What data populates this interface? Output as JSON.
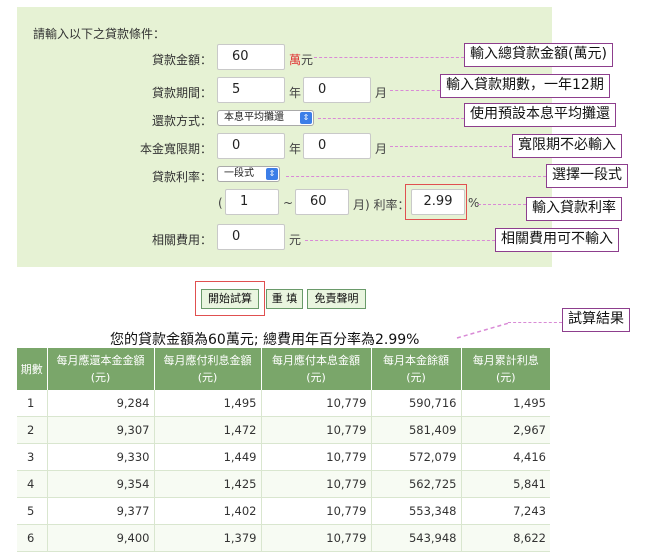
{
  "form": {
    "heading": "請輸入以下之貸款條件：",
    "amount": {
      "label": "貸款金額：",
      "value": "60",
      "unit_red": "萬",
      "unit": "元"
    },
    "period": {
      "label": "貸款期間：",
      "years": "5",
      "years_unit": "年",
      "months": "0",
      "months_unit": "月"
    },
    "method": {
      "label": "還款方式：",
      "selected": "本息平均攤還"
    },
    "grace": {
      "label": "本金寬限期：",
      "years": "0",
      "years_unit": "年",
      "months": "0",
      "months_unit": "月"
    },
    "rate": {
      "label": "貸款利率：",
      "selected": "一段式",
      "paren_open": "(",
      "from": "1",
      "tilde": "~",
      "to": "60",
      "month_label": "月) 利率：",
      "value": "2.99",
      "percent": "%"
    },
    "fee": {
      "label": "相關費用：",
      "value": "0",
      "unit": "元"
    }
  },
  "callouts": {
    "amount": "輸入總貸款金額(萬元)",
    "period": "輸入貸款期數，一年12期",
    "method": "使用預設本息平均攤還",
    "grace": "寬限期不必輸入",
    "rate_type": "選擇一段式",
    "rate": "輸入貸款利率",
    "fee": "相關費用可不輸入",
    "result": "試算結果"
  },
  "buttons": {
    "calculate": "開始試算",
    "reset": "重 填",
    "disclaimer": "免責聲明"
  },
  "summary": "您的貸款金額為60萬元; 總費用年百分率為2.99%",
  "table": {
    "headers": [
      "期數",
      "每月應還本金金額\n(元)",
      "每月應付利息金額\n(元)",
      "每月應付本息金額\n(元)",
      "每月本金餘額\n(元)",
      "每月累計利息\n(元)"
    ],
    "rows": [
      [
        "1",
        "9,284",
        "1,495",
        "10,779",
        "590,716",
        "1,495"
      ],
      [
        "2",
        "9,307",
        "1,472",
        "10,779",
        "581,409",
        "2,967"
      ],
      [
        "3",
        "9,330",
        "1,449",
        "10,779",
        "572,079",
        "4,416"
      ],
      [
        "4",
        "9,354",
        "1,425",
        "10,779",
        "562,725",
        "5,841"
      ],
      [
        "5",
        "9,377",
        "1,402",
        "10,779",
        "553,348",
        "7,243"
      ],
      [
        "6",
        "9,400",
        "1,379",
        "10,779",
        "543,948",
        "8,622"
      ]
    ]
  },
  "colors": {
    "panel": "#e6f2d4",
    "callout_border": "#8d3e8d",
    "dash": "#d98ad6",
    "highlight": "#e05050",
    "table_header": "#7aa66a"
  }
}
